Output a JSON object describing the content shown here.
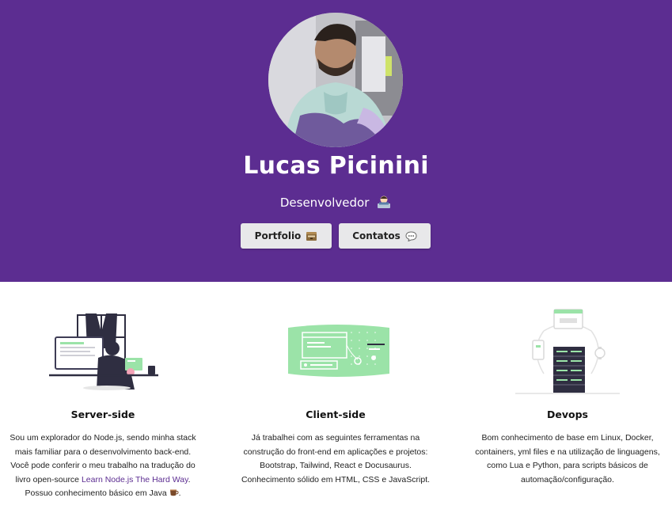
{
  "hero": {
    "background_color": "#5c2d91",
    "name": "Lucas Picinini",
    "role": "Desenvolvedor",
    "role_emoji": "technologist-emoji",
    "buttons": [
      {
        "label": "Portfolio",
        "icon": "card-file-box-icon"
      },
      {
        "label": "Contatos",
        "icon": "speech-bubble-icon"
      }
    ]
  },
  "features": [
    {
      "title": "Server-side",
      "text_before_link": "Sou um explorador do Node.js, sendo minha stack mais familiar para o desenvolvimento back-end. Você pode conferir o meu trabalho na tradução do livro open-source ",
      "link_text": "Learn Node.js The Hard Way",
      "text_after_link": ". Possuo conhecimento básico em Java",
      "trailing_emoji": "coffee-icon"
    },
    {
      "title": "Client-side",
      "text": "Já trabalhei com as seguintes ferramentas na construção do front-end em aplicações e projetos: Bootstrap, Tailwind, React e Docusaurus. Conhecimento sólido em HTML, CSS e JavaScript."
    },
    {
      "title": "Devops",
      "text": "Bom conhecimento de base em Linux, Docker, containers, yml files e na utilização de linguagens, como Lua e Python, para scripts básicos de automação/configuração."
    }
  ],
  "colors": {
    "accent": "#5c2d91",
    "illustration_green": "#9be3a8",
    "button_bg": "#e8e8ea"
  }
}
